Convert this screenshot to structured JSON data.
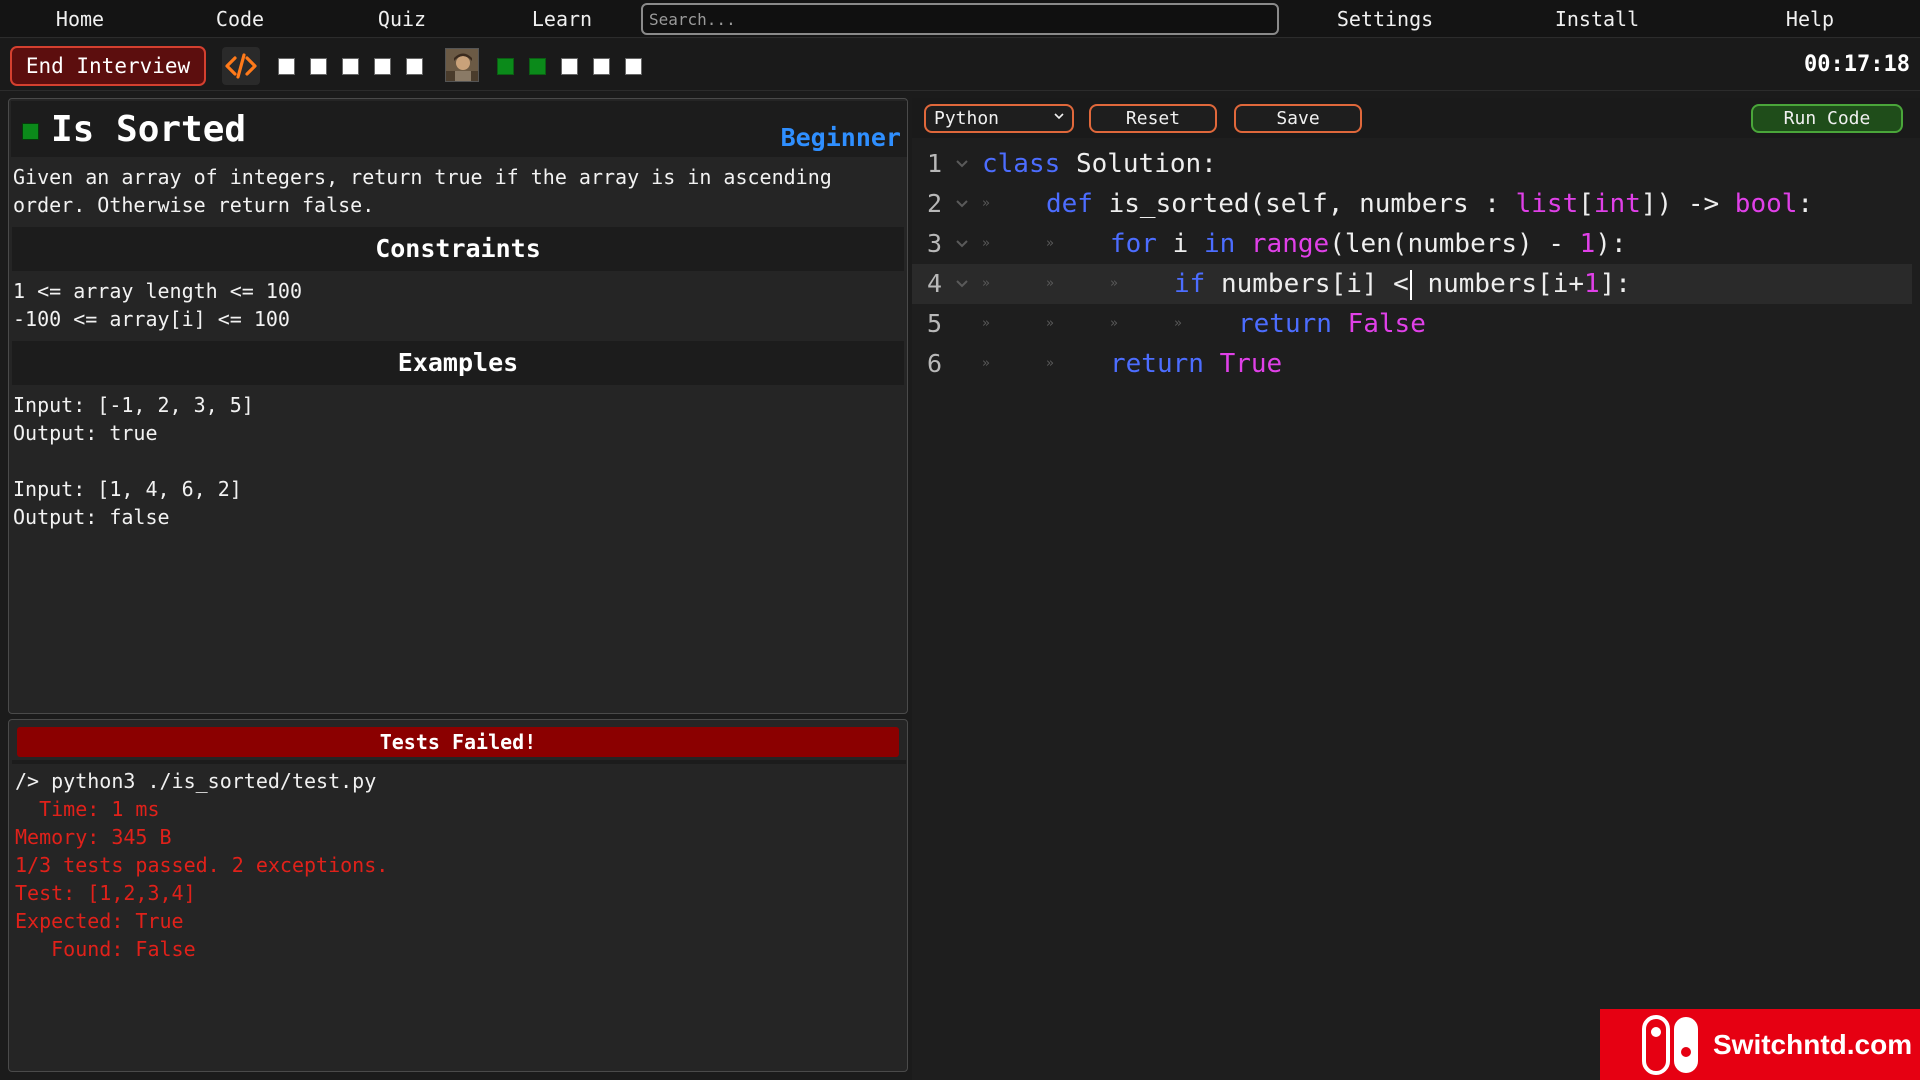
{
  "nav": {
    "items": [
      "Home",
      "Code",
      "Quiz",
      "Learn",
      "Settings",
      "Install",
      "Help"
    ],
    "search_placeholder": "Search..."
  },
  "toolbar": {
    "end_interview_label": "End Interview",
    "timer": "00:17:18",
    "progress_squares": [
      "white",
      "white",
      "white",
      "white",
      "white"
    ],
    "status_squares": [
      "green",
      "green",
      "white",
      "white",
      "white"
    ]
  },
  "problem": {
    "title": "Is Sorted",
    "difficulty": "Beginner",
    "description": "Given an array of integers, return true if the array is in ascending\norder. Otherwise return false.",
    "constraints_heading": "Constraints",
    "constraints": "1 <= array length <= 100\n-100 <= array[i] <= 100",
    "examples_heading": "Examples",
    "examples": "Input: [-1, 2, 3, 5]\nOutput: true\n\nInput: [1, 4, 6, 2]\nOutput: false"
  },
  "output": {
    "banner": "Tests Failed!",
    "command": "/> python3 ./is_sorted/test.py",
    "lines": [
      "  Time: 1 ms",
      "Memory: 345 B",
      "1/3 tests passed. 2 exceptions.",
      "Test: [1,2,3,4]",
      "Expected: True",
      "   Found: False"
    ]
  },
  "editor": {
    "language": "Python",
    "reset_label": "Reset",
    "save_label": "Save",
    "run_label": "Run Code",
    "line_numbers": [
      "1",
      "2",
      "3",
      "4",
      "5",
      "6"
    ],
    "code": {
      "l1": [
        "class",
        "Solution:"
      ],
      "l2": [
        "def",
        "is_sorted(self, numbers : ",
        "list",
        "[",
        "int",
        "]) -> ",
        "bool",
        ":"
      ],
      "l3": [
        "for",
        "i",
        "in",
        "range",
        "(len(numbers) - ",
        "1",
        "):"
      ],
      "l4": [
        "if",
        "numbers[i] <",
        " numbers[i+",
        "1",
        "]:"
      ],
      "l5": [
        "return",
        "False"
      ],
      "l6": [
        "return",
        "True"
      ]
    }
  },
  "watermark": {
    "text": "Switchntd.com"
  },
  "colors": {
    "keyword": "#4c6dff",
    "type": "#e040e8",
    "error": "#e0211a",
    "difficulty": "#2f8fff",
    "button_border": "#e0683b",
    "run_border": "#4aa63a",
    "fail_banner": "#8b0000"
  }
}
